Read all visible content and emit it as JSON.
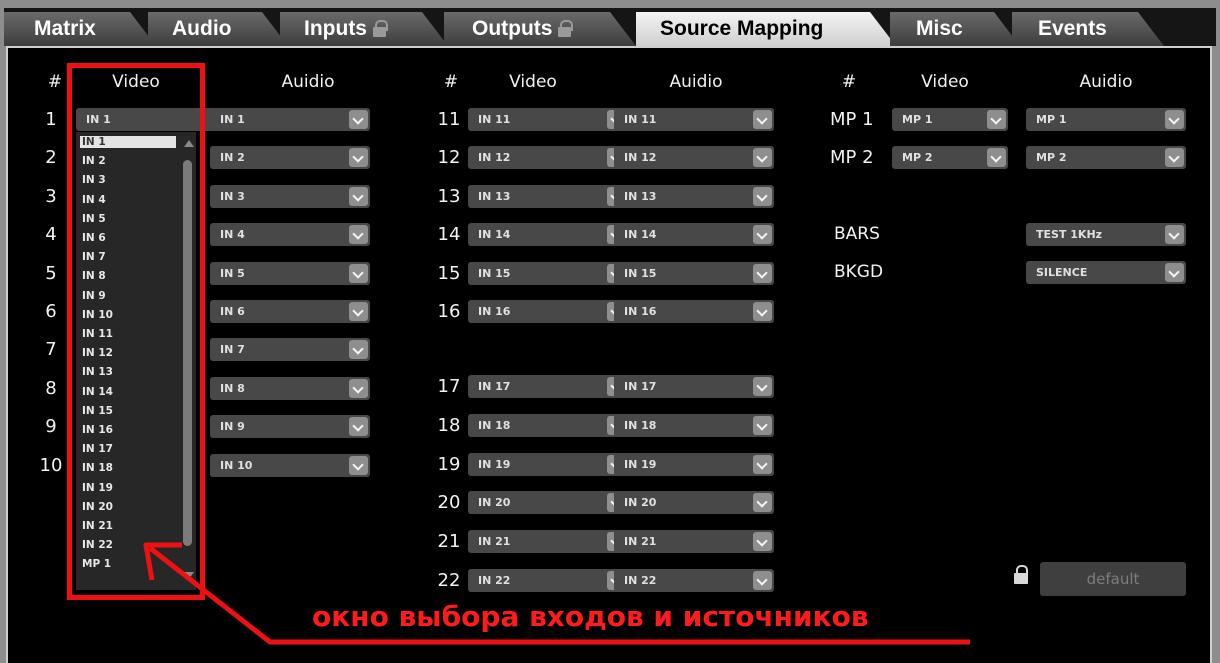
{
  "tabs": [
    {
      "label": "Matrix",
      "lock": false
    },
    {
      "label": "Audio",
      "lock": false
    },
    {
      "label": "Inputs",
      "lock": true
    },
    {
      "label": "Outputs",
      "lock": true
    },
    {
      "label": "Source Mapping",
      "lock": false,
      "active": true
    },
    {
      "label": "Misc",
      "lock": false
    },
    {
      "label": "Events",
      "lock": false
    }
  ],
  "headers": {
    "hash": "#",
    "video": "Video",
    "audio": "Auidio"
  },
  "group1": {
    "rows": [
      {
        "num": "1",
        "video": "IN 1",
        "audio": "IN 1"
      },
      {
        "num": "2",
        "video": null,
        "audio": "IN 2"
      },
      {
        "num": "3",
        "video": null,
        "audio": "IN 3"
      },
      {
        "num": "4",
        "video": null,
        "audio": "IN 4"
      },
      {
        "num": "5",
        "video": null,
        "audio": "IN 5"
      },
      {
        "num": "6",
        "video": null,
        "audio": "IN 6"
      },
      {
        "num": "7",
        "video": null,
        "audio": "IN 7"
      },
      {
        "num": "8",
        "video": null,
        "audio": "IN 8"
      },
      {
        "num": "9",
        "video": null,
        "audio": "IN 9"
      },
      {
        "num": "10",
        "video": null,
        "audio": "IN 10"
      }
    ]
  },
  "group2": {
    "rows": [
      {
        "num": "11",
        "video": "IN 11",
        "audio": "IN 11"
      },
      {
        "num": "12",
        "video": "IN 12",
        "audio": "IN 12"
      },
      {
        "num": "13",
        "video": "IN 13",
        "audio": "IN 13"
      },
      {
        "num": "14",
        "video": "IN 14",
        "audio": "IN 14"
      },
      {
        "num": "15",
        "video": "IN 15",
        "audio": "IN 15"
      },
      {
        "num": "16",
        "video": "IN 16",
        "audio": "IN 16"
      },
      {
        "num": "17",
        "video": "IN 17",
        "audio": "IN 17"
      },
      {
        "num": "18",
        "video": "IN 18",
        "audio": "IN 18"
      },
      {
        "num": "19",
        "video": "IN 19",
        "audio": "IN 19"
      },
      {
        "num": "20",
        "video": "IN 20",
        "audio": "IN 20"
      },
      {
        "num": "21",
        "video": "IN 21",
        "audio": "IN 21"
      },
      {
        "num": "22",
        "video": "IN 22",
        "audio": "IN 22"
      }
    ]
  },
  "group3": {
    "rows": [
      {
        "num": "MP 1",
        "video": "MP 1",
        "audio": "MP 1"
      },
      {
        "num": "MP 2",
        "video": "MP 2",
        "audio": "MP 2"
      }
    ],
    "bars": {
      "label": "BARS",
      "audio": "TEST 1KHz"
    },
    "bkgd": {
      "label": "BKGD",
      "audio": "SILENCE"
    }
  },
  "open_list": {
    "selected": "IN 1",
    "items": [
      "IN 1",
      "IN 2",
      "IN 3",
      "IN 4",
      "IN 5",
      "IN 6",
      "IN 7",
      "IN 8",
      "IN 9",
      "IN 10",
      "IN 11",
      "IN 12",
      "IN 13",
      "IN 14",
      "IN 15",
      "IN 16",
      "IN 17",
      "IN 18",
      "IN 19",
      "IN 20",
      "IN 21",
      "IN 22",
      "MP 1"
    ]
  },
  "default_button": "default",
  "annotation": "окно выбора входов и источников",
  "colors": {
    "highlight": "#ee1111",
    "active_tab": "#e8e8e8",
    "panel": "#000000"
  }
}
